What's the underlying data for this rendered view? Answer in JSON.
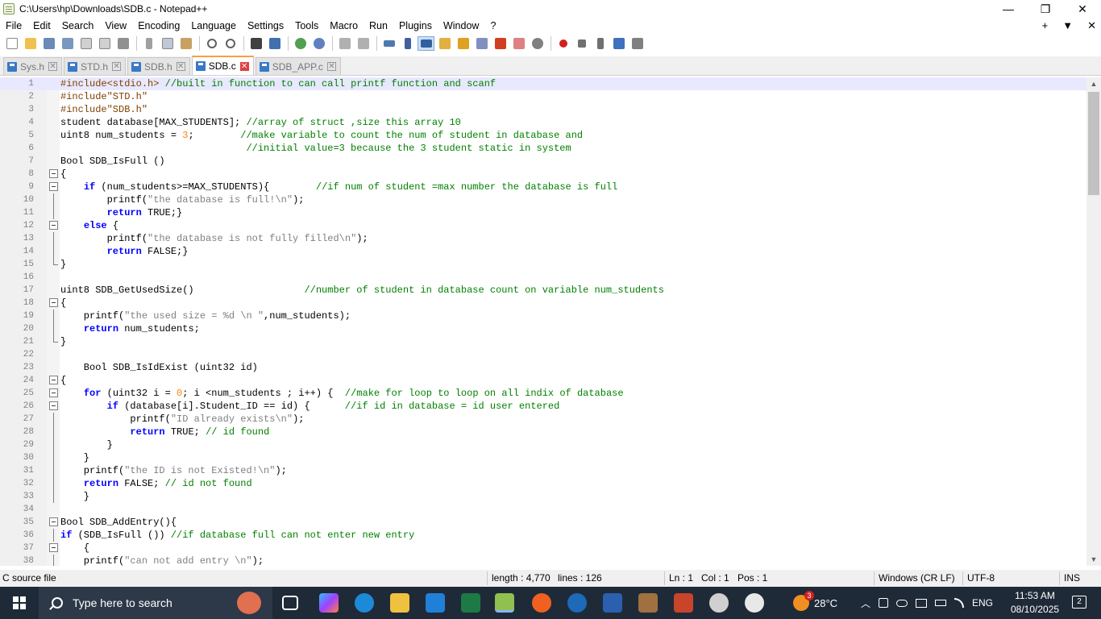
{
  "window": {
    "title": "C:\\Users\\hp\\Downloads\\SDB.c - Notepad++",
    "minimize_glyph": "—",
    "maximize_glyph": "❐",
    "close_glyph": "✕"
  },
  "menu": {
    "items": [
      "File",
      "Edit",
      "Search",
      "View",
      "Encoding",
      "Language",
      "Settings",
      "Tools",
      "Macro",
      "Run",
      "Plugins",
      "Window",
      "?"
    ],
    "right_plus": "+",
    "right_dropdown": "▼",
    "right_close": "✕"
  },
  "tabs": [
    {
      "label": "Sys.h",
      "active": false,
      "close": "✕"
    },
    {
      "label": "STD.h",
      "active": false,
      "close": "✕"
    },
    {
      "label": "SDB.h",
      "active": false,
      "close": "✕"
    },
    {
      "label": "SDB.c",
      "active": true,
      "close": "✕"
    },
    {
      "label": "SDB_APP.c",
      "active": false,
      "close": "✕"
    }
  ],
  "editor": {
    "lines": [
      {
        "n": "1",
        "code": [
          [
            "p",
            "#include<stdio.h>"
          ],
          [
            "t",
            " "
          ],
          [
            "c",
            "//built in function to can call printf function and scanf"
          ]
        ]
      },
      {
        "n": "2",
        "code": [
          [
            "p",
            "#include\"STD.h\""
          ]
        ]
      },
      {
        "n": "3",
        "code": [
          [
            "p",
            "#include\"SDB.h\""
          ]
        ]
      },
      {
        "n": "4",
        "code": [
          [
            "t",
            "student database[MAX_STUDENTS]; "
          ],
          [
            "c",
            "//array of struct ,size this array 10"
          ]
        ]
      },
      {
        "n": "5",
        "code": [
          [
            "t",
            "uint8 num_students = "
          ],
          [
            "n",
            "3"
          ],
          [
            "t",
            ";        "
          ],
          [
            "c",
            "//make variable to count the num of student in database and"
          ]
        ]
      },
      {
        "n": "6",
        "code": [
          [
            "t",
            "                                "
          ],
          [
            "c",
            "//initial value=3 because the 3 student static in system"
          ]
        ]
      },
      {
        "n": "7",
        "code": [
          [
            "t",
            "Bool SDB_IsFull ()"
          ]
        ]
      },
      {
        "n": "8",
        "code": [
          [
            "t",
            "{"
          ]
        ]
      },
      {
        "n": "9",
        "code": [
          [
            "t",
            "    "
          ],
          [
            "k",
            "if"
          ],
          [
            "t",
            " (num_students>=MAX_STUDENTS){        "
          ],
          [
            "c",
            "//if num of student =max number the database is full"
          ]
        ]
      },
      {
        "n": "10",
        "code": [
          [
            "t",
            "        printf("
          ],
          [
            "s",
            "\"the database is full!\\n\""
          ],
          [
            "t",
            ");"
          ]
        ]
      },
      {
        "n": "11",
        "code": [
          [
            "t",
            "        "
          ],
          [
            "k",
            "return"
          ],
          [
            "t",
            " TRUE;}"
          ]
        ]
      },
      {
        "n": "12",
        "code": [
          [
            "t",
            "    "
          ],
          [
            "k",
            "else"
          ],
          [
            "t",
            " {"
          ]
        ]
      },
      {
        "n": "13",
        "code": [
          [
            "t",
            "        printf("
          ],
          [
            "s",
            "\"the database is not fully filled\\n\""
          ],
          [
            "t",
            ");"
          ]
        ]
      },
      {
        "n": "14",
        "code": [
          [
            "t",
            "        "
          ],
          [
            "k",
            "return"
          ],
          [
            "t",
            " FALSE;}"
          ]
        ]
      },
      {
        "n": "15",
        "code": [
          [
            "t",
            "}"
          ]
        ]
      },
      {
        "n": "16",
        "code": [
          [
            "t",
            ""
          ]
        ]
      },
      {
        "n": "17",
        "code": [
          [
            "t",
            "uint8 SDB_GetUsedSize()                   "
          ],
          [
            "c",
            "//number of student in database count on variable num_students"
          ]
        ]
      },
      {
        "n": "18",
        "code": [
          [
            "t",
            "{"
          ]
        ]
      },
      {
        "n": "19",
        "code": [
          [
            "t",
            "    printf("
          ],
          [
            "s",
            "\"the used size = %d \\n \""
          ],
          [
            "t",
            ",num_students);"
          ]
        ]
      },
      {
        "n": "20",
        "code": [
          [
            "t",
            "    "
          ],
          [
            "k",
            "return"
          ],
          [
            "t",
            " num_students;"
          ]
        ]
      },
      {
        "n": "21",
        "code": [
          [
            "t",
            "}"
          ]
        ]
      },
      {
        "n": "22",
        "code": [
          [
            "t",
            ""
          ]
        ]
      },
      {
        "n": "23",
        "code": [
          [
            "t",
            "    Bool SDB_IsIdExist (uint32 id)"
          ]
        ]
      },
      {
        "n": "24",
        "code": [
          [
            "t",
            "{"
          ]
        ]
      },
      {
        "n": "25",
        "code": [
          [
            "t",
            "    "
          ],
          [
            "k",
            "for"
          ],
          [
            "t",
            " (uint32 i = "
          ],
          [
            "n",
            "0"
          ],
          [
            "t",
            "; i <num_students ; i++) {  "
          ],
          [
            "c",
            "//make for loop to loop on all indix of database"
          ]
        ]
      },
      {
        "n": "26",
        "code": [
          [
            "t",
            "        "
          ],
          [
            "k",
            "if"
          ],
          [
            "t",
            " (database[i].Student_ID == id) {      "
          ],
          [
            "c",
            "//if id in database = id user entered"
          ]
        ]
      },
      {
        "n": "27",
        "code": [
          [
            "t",
            "            printf("
          ],
          [
            "s",
            "\"ID already exists\\n\""
          ],
          [
            "t",
            ");"
          ]
        ]
      },
      {
        "n": "28",
        "code": [
          [
            "t",
            "            "
          ],
          [
            "k",
            "return"
          ],
          [
            "t",
            " TRUE; "
          ],
          [
            "c",
            "// id found"
          ]
        ]
      },
      {
        "n": "29",
        "code": [
          [
            "t",
            "        }"
          ]
        ]
      },
      {
        "n": "30",
        "code": [
          [
            "t",
            "    }"
          ]
        ]
      },
      {
        "n": "31",
        "code": [
          [
            "t",
            "    printf("
          ],
          [
            "s",
            "\"the ID is not Existed!\\n\""
          ],
          [
            "t",
            ");"
          ]
        ]
      },
      {
        "n": "32",
        "code": [
          [
            "t",
            "    "
          ],
          [
            "k",
            "return"
          ],
          [
            "t",
            " FALSE; "
          ],
          [
            "c",
            "// id not found"
          ]
        ]
      },
      {
        "n": "33",
        "code": [
          [
            "t",
            "    }"
          ]
        ]
      },
      {
        "n": "34",
        "code": [
          [
            "t",
            ""
          ]
        ]
      },
      {
        "n": "35",
        "code": [
          [
            "t",
            "Bool SDB_AddEntry(){"
          ]
        ]
      },
      {
        "n": "36",
        "code": [
          [
            "k",
            "if"
          ],
          [
            "t",
            " (SDB_IsFull ()) "
          ],
          [
            "c",
            "//if database full can not enter new entry"
          ]
        ]
      },
      {
        "n": "37",
        "code": [
          [
            "t",
            "    {"
          ]
        ]
      },
      {
        "n": "38",
        "code": [
          [
            "t",
            "    printf("
          ],
          [
            "s",
            "\"can not add entry \\n\""
          ],
          [
            "t",
            ");"
          ]
        ]
      }
    ]
  },
  "status": {
    "filetype": "C source file",
    "length": "length : 4,770",
    "lines": "lines : 126",
    "ln": "Ln : 1",
    "col": "Col : 1",
    "pos": "Pos : 1",
    "eol": "Windows (CR LF)",
    "encoding": "UTF-8",
    "mode": "INS"
  },
  "taskbar": {
    "search_placeholder": "Type here to search",
    "weather_temp": "28°C",
    "weather_badge": "3",
    "language": "ENG",
    "time": "11:53 AM",
    "date": "08/10/2025",
    "notifications": "2",
    "apps": [
      "copilot-icon",
      "edge-icon",
      "file-explorer-icon",
      "mail-icon",
      "excel-icon",
      "notepadpp-icon",
      "brave-icon",
      "edge-dev-icon",
      "word-icon",
      "winrar-icon",
      "powerpoint-icon",
      "settings-icon",
      "photos-icon"
    ],
    "colors": {
      "taskbar_bg": "#1f2a38",
      "search_bg": "#2d3848"
    }
  }
}
